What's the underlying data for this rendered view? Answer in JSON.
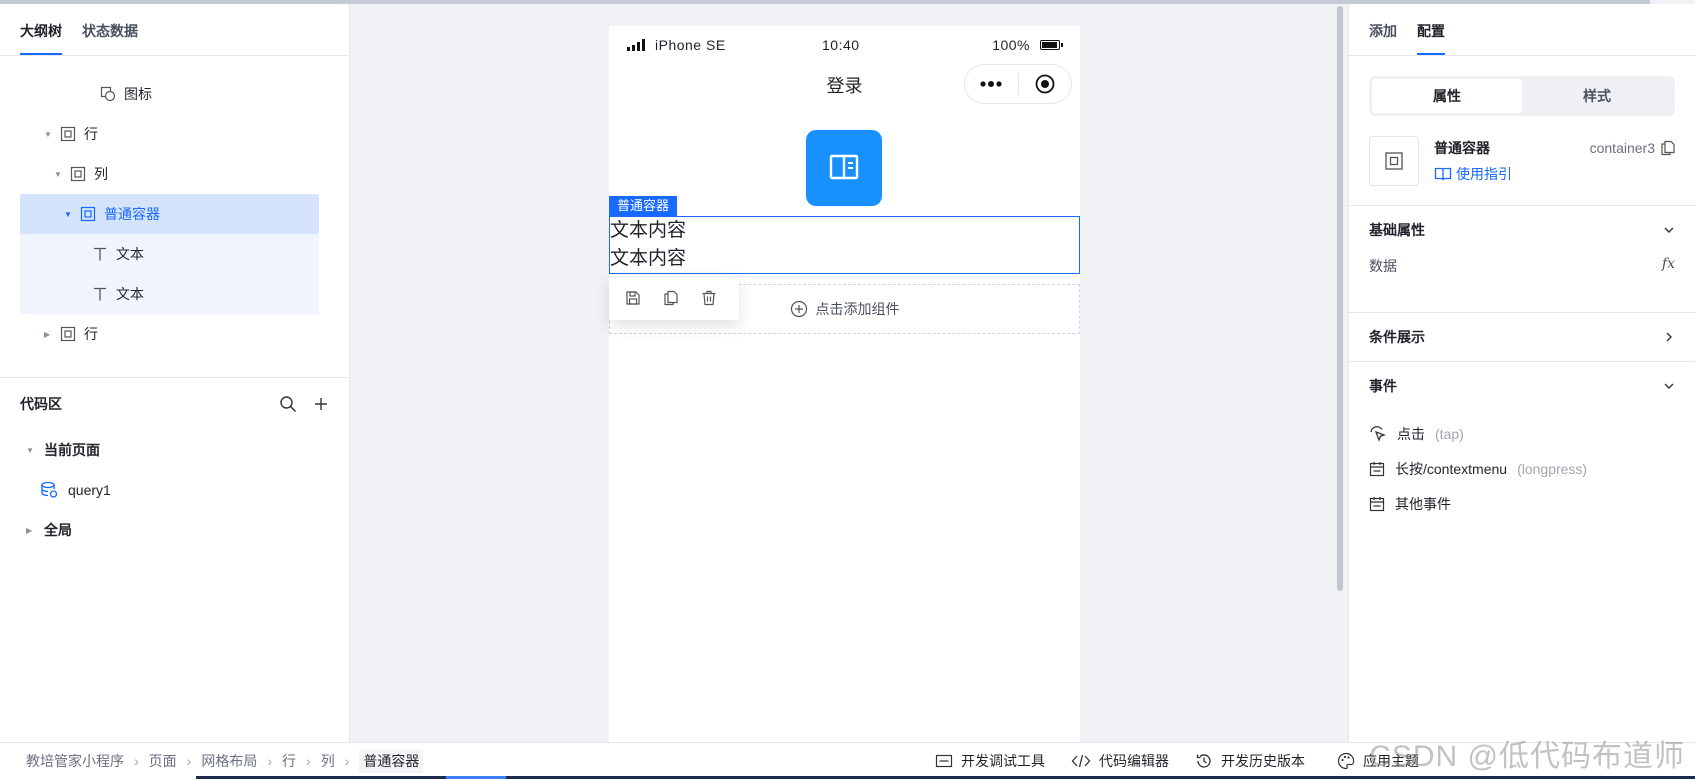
{
  "left_panel": {
    "tabs": [
      "大纲树",
      "状态数据"
    ],
    "tree": [
      {
        "label": "图标",
        "icon": "icon-component-icon"
      },
      {
        "label": "行",
        "icon": "box-icon"
      },
      {
        "label": "列",
        "icon": "box-icon"
      },
      {
        "label": "普通容器",
        "icon": "box-icon"
      },
      {
        "label": "文本",
        "icon": "text-icon"
      },
      {
        "label": "文本",
        "icon": "text-icon"
      },
      {
        "label": "行",
        "icon": "box-icon"
      }
    ],
    "code_area": {
      "title": "代码区",
      "current_page": "当前页面",
      "query": "query1",
      "global": "全局"
    }
  },
  "phone": {
    "carrier": "iPhone SE",
    "time": "10:40",
    "battery": "100%",
    "title": "登录",
    "selected_label": "普通容器",
    "text_lines": [
      "文本内容",
      "文本内容"
    ],
    "add_component": "点击添加组件"
  },
  "right_panel": {
    "tabs": [
      "添加",
      "配置"
    ],
    "segments": [
      "属性",
      "样式"
    ],
    "component": {
      "name": "普通容器",
      "guide": "使用指引",
      "id": "container3"
    },
    "sections": {
      "basic": "基础属性",
      "data_label": "数据",
      "fx": "fx",
      "condition": "条件展示",
      "events": "事件"
    },
    "events": [
      {
        "name": "点击",
        "hint": "(tap)"
      },
      {
        "name": "长按/contextmenu",
        "hint": "(longpress)"
      },
      {
        "name": "其他事件",
        "hint": ""
      }
    ]
  },
  "bottom_bar": {
    "breadcrumb": [
      "教培管家小程序",
      "页面",
      "网格布局",
      "行",
      "列",
      "普通容器"
    ],
    "tools": [
      "开发调试工具",
      "代码编辑器",
      "开发历史版本",
      "应用主题"
    ],
    "watermark": "CSDN @低代码布道师"
  },
  "colors": {
    "accent": "#1769ff",
    "logo_bg": "#1890ff",
    "selected_row": "#d6e4fb"
  }
}
